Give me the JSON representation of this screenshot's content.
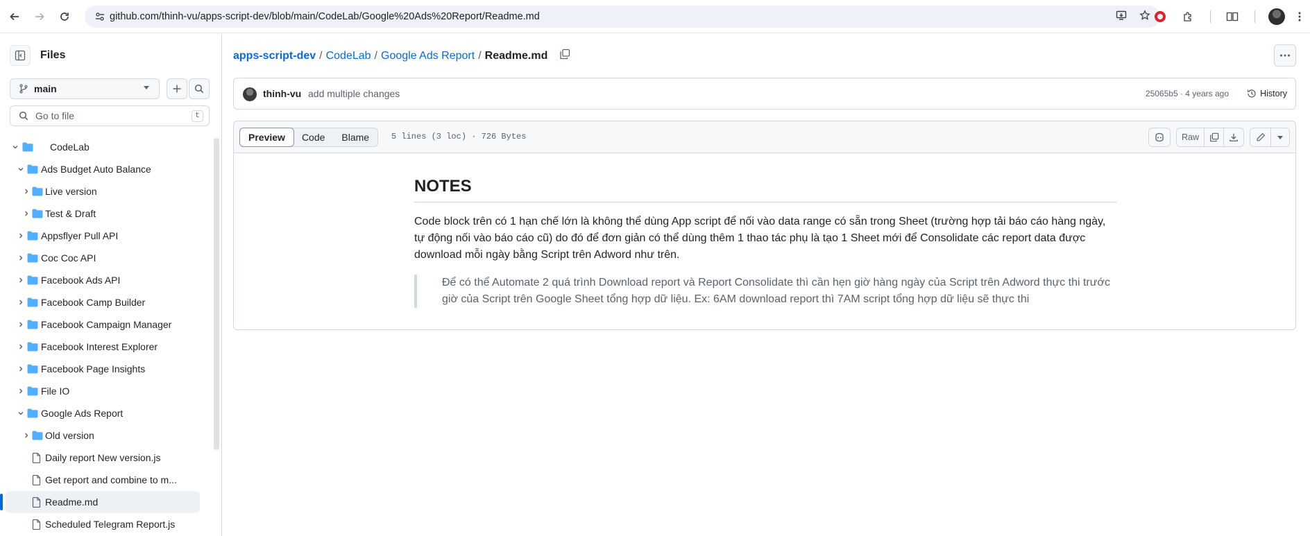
{
  "browser": {
    "url": "github.com/thinh-vu/apps-script-dev/blob/main/CodeLab/Google%20Ads%20Report/Readme.md"
  },
  "sidebar": {
    "title": "Files",
    "branch": "main",
    "goto_placeholder": "Go to file",
    "goto_shortcut": "t",
    "tree": [
      {
        "label": "CodeLab",
        "type": "folder",
        "expanded": true,
        "depth": 0
      },
      {
        "label": "Ads Budget Auto Balance",
        "type": "folder",
        "expanded": true,
        "depth": 1
      },
      {
        "label": "Live version",
        "type": "folder",
        "expanded": false,
        "depth": 2
      },
      {
        "label": "Test & Draft",
        "type": "folder",
        "expanded": false,
        "depth": 2
      },
      {
        "label": "Appsflyer Pull API",
        "type": "folder",
        "expanded": false,
        "depth": 1
      },
      {
        "label": "Coc Coc API",
        "type": "folder",
        "expanded": false,
        "depth": 1
      },
      {
        "label": "Facebook Ads API",
        "type": "folder",
        "expanded": false,
        "depth": 1
      },
      {
        "label": "Facebook Camp Builder",
        "type": "folder",
        "expanded": false,
        "depth": 1
      },
      {
        "label": "Facebook Campaign Manager",
        "type": "folder",
        "expanded": false,
        "depth": 1
      },
      {
        "label": "Facebook Interest Explorer",
        "type": "folder",
        "expanded": false,
        "depth": 1
      },
      {
        "label": "Facebook Page Insights",
        "type": "folder",
        "expanded": false,
        "depth": 1
      },
      {
        "label": "File IO",
        "type": "folder",
        "expanded": false,
        "depth": 1
      },
      {
        "label": "Google Ads Report",
        "type": "folder",
        "expanded": true,
        "depth": 1
      },
      {
        "label": "Old version",
        "type": "folder",
        "expanded": false,
        "depth": 2
      },
      {
        "label": "Daily report New version.js",
        "type": "file",
        "depth": 2
      },
      {
        "label": "Get report and combine to m...",
        "type": "file",
        "depth": 2
      },
      {
        "label": "Readme.md",
        "type": "file",
        "depth": 2,
        "active": true
      },
      {
        "label": "Scheduled Telegram Report.js",
        "type": "file",
        "depth": 2
      }
    ]
  },
  "breadcrumb": {
    "repo": "apps-script-dev",
    "folder1": "CodeLab",
    "folder2": "Google Ads Report",
    "file": "Readme.md",
    "sep": "/"
  },
  "commit": {
    "author": "thinh-vu",
    "message": "add multiple changes",
    "meta": "25065b5 · 4 years ago",
    "history_label": "History"
  },
  "file": {
    "tabs": [
      "Preview",
      "Code",
      "Blame"
    ],
    "active_tab": "Preview",
    "info": "5 lines (3 loc) · 726 Bytes",
    "raw_label": "Raw"
  },
  "content": {
    "heading": "NOTES",
    "paragraph": "Code block trên có 1 hạn chế lớn là không thể dùng App script để nối vào data range có sẵn trong Sheet (trường hợp tải báo cáo hàng ngày, tự động nối vào báo cáo cũ) do đó để đơn giản có thể dùng thêm 1 thao tác phụ là tạo 1 Sheet mới để Consolidate các report data được download mỗi ngày bằng Script trên Adword như trên.",
    "quote": "Để có thể Automate 2 quá trình Download report và Report Consolidate thì cần hẹn giờ hàng ngày của Script trên Adword thực thi trước giờ của Script trên Google Sheet tổng hợp dữ liệu. Ex: 6AM download report thì 7AM script tổng hợp dữ liệu sẽ thực thi"
  },
  "colors": {
    "link": "#0969da",
    "folder": "#54aeff",
    "border": "#d1d9e0",
    "muted": "#59636e"
  }
}
